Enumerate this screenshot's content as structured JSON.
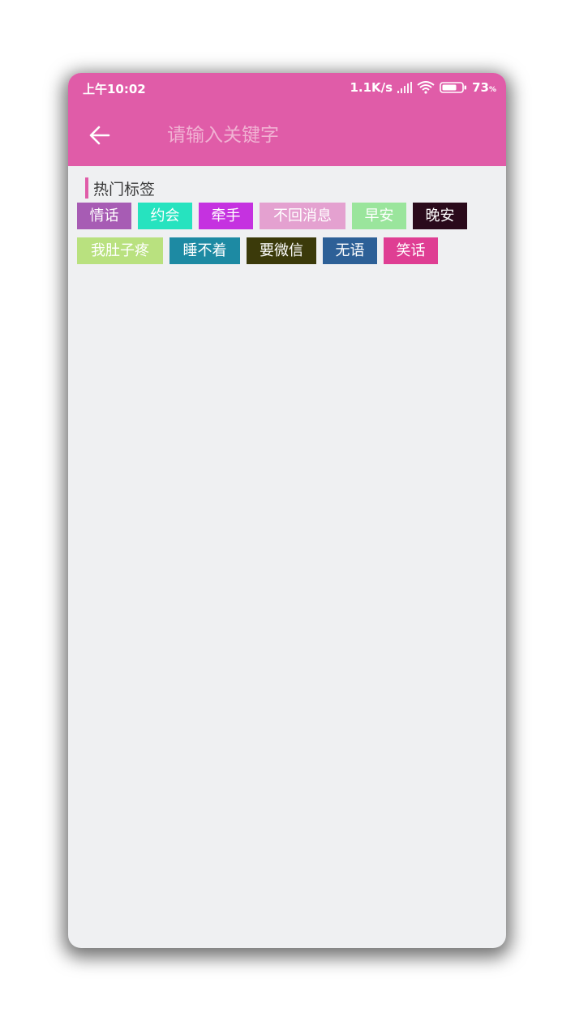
{
  "status_bar": {
    "time": "上午10:02",
    "net_speed": "1.1K/s",
    "battery_level": "73",
    "battery_unit": "%"
  },
  "toolbar": {
    "back_icon": "arrow-left-icon",
    "search_placeholder": "请输入关键字",
    "search_value": ""
  },
  "hot_tags": {
    "title": "热门标签",
    "accent": "#e05ca8",
    "tags": [
      {
        "label": "情话",
        "color": "#a75cb4"
      },
      {
        "label": "约会",
        "color": "#26e3bf"
      },
      {
        "label": "牵手",
        "color": "#c532e0"
      },
      {
        "label": "不回消息",
        "color": "#e4a1d0"
      },
      {
        "label": "早安",
        "color": "#9ae59c"
      },
      {
        "label": "晚安",
        "color": "#2a0a1b"
      },
      {
        "label": "我肚子疼",
        "color": "#b9e17f"
      },
      {
        "label": "睡不着",
        "color": "#1d8aa3"
      },
      {
        "label": "要微信",
        "color": "#3b3a0a"
      },
      {
        "label": "无语",
        "color": "#2d6097"
      },
      {
        "label": "笑话",
        "color": "#df3e93"
      }
    ]
  },
  "colors": {
    "primary": "#e05ca8",
    "background": "#eff0f2"
  }
}
